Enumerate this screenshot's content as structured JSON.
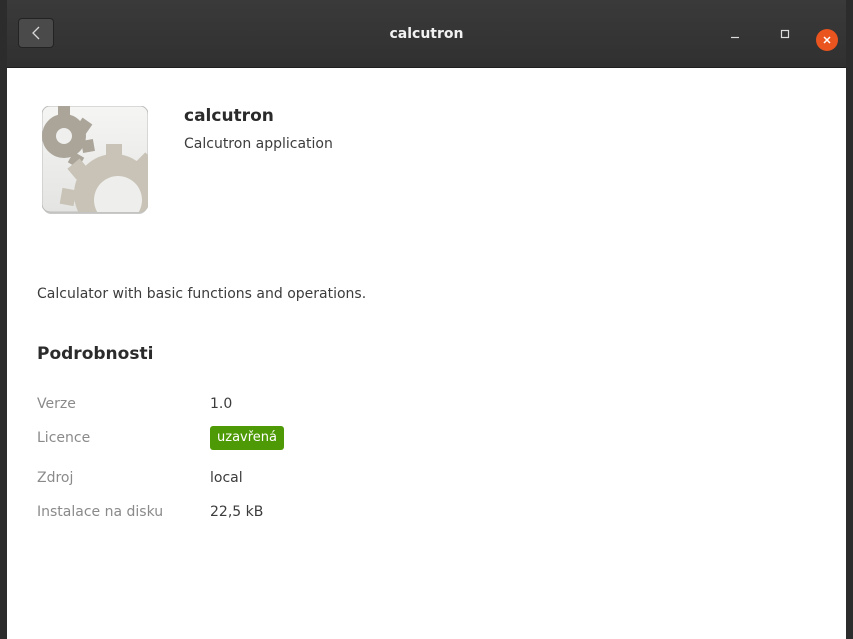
{
  "window": {
    "title": "calcutron"
  },
  "header": {
    "back_icon": "chevron-left-icon",
    "minimize_icon": "minimize-icon",
    "maximize_icon": "maximize-icon",
    "close_icon": "close-icon",
    "close_color": "#e9541f"
  },
  "app": {
    "name": "calcutron",
    "summary": "Calcutron application",
    "icon": "gear-icon",
    "description": "Calculator with basic functions and operations."
  },
  "details": {
    "heading": "Podrobnosti",
    "rows": [
      {
        "label": "Verze",
        "value": "1.0"
      },
      {
        "label": "Licence",
        "value": "uzavřená"
      },
      {
        "label": "Zdroj",
        "value": "local"
      },
      {
        "label": "Instalace na disku",
        "value": "22,5 kB"
      }
    ],
    "license_color": "#4e9a06"
  }
}
